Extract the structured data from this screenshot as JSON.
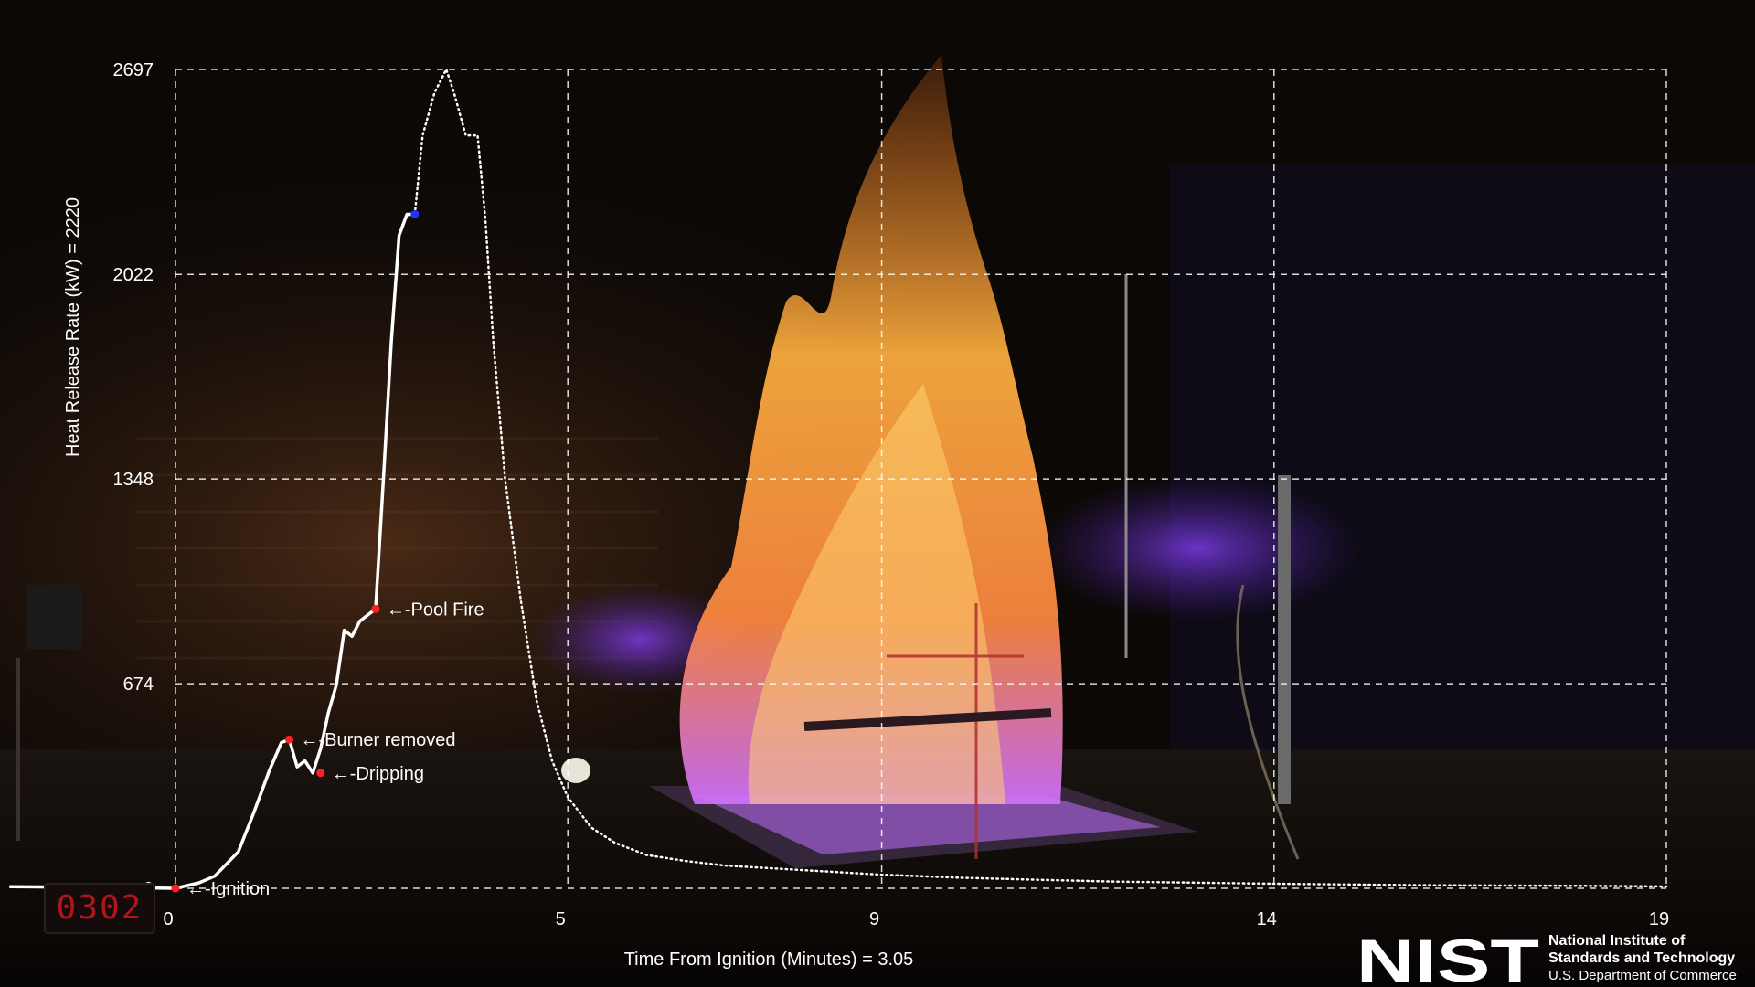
{
  "chart_data": {
    "type": "line",
    "xlabel": "Time From Ignition (Minutes) = 3.05",
    "ylabel": "Heat Release Rate (kW) = 2220",
    "xlim": [
      0,
      19
    ],
    "ylim": [
      0,
      2697
    ],
    "x_ticks": [
      0,
      5,
      9,
      14,
      19
    ],
    "x_tick_labels": [
      "0",
      "5",
      "9",
      "14",
      "19"
    ],
    "y_ticks": [
      0,
      674,
      1348,
      2022,
      2697
    ],
    "y_tick_labels": [
      "0",
      "674",
      "1348",
      "2022",
      "2697"
    ],
    "grid": true,
    "series": [
      {
        "style": "solid",
        "color": "#ffffff",
        "x": [
          -2.1,
          -1.0,
          0,
          0.3,
          0.5,
          0.8,
          1.0,
          1.2,
          1.35,
          1.45,
          1.55,
          1.65,
          1.75,
          1.85,
          1.95,
          2.05,
          2.15,
          2.25,
          2.35,
          2.45,
          2.55,
          2.65,
          2.75,
          2.85,
          2.95,
          3.05
        ],
        "y": [
          5,
          3,
          0,
          18,
          40,
          120,
          250,
          390,
          480,
          490,
          400,
          420,
          380,
          460,
          580,
          670,
          850,
          830,
          880,
          900,
          920,
          1350,
          1800,
          2150,
          2220,
          2220
        ]
      },
      {
        "style": "dotted",
        "color": "#ffffff",
        "x": [
          3.05,
          3.15,
          3.3,
          3.45,
          3.55,
          3.7,
          3.85,
          3.95,
          4.05,
          4.2,
          4.4,
          4.6,
          4.8,
          5.0,
          5.3,
          5.6,
          6.0,
          6.5,
          7.0,
          8.0,
          9.0,
          10.0,
          11.0,
          12.0,
          14.0,
          16.0,
          18.0,
          19.0
        ],
        "y": [
          2220,
          2480,
          2620,
          2697,
          2620,
          2480,
          2480,
          2200,
          1800,
          1350,
          950,
          620,
          420,
          300,
          200,
          150,
          110,
          90,
          75,
          60,
          45,
          35,
          28,
          22,
          15,
          10,
          8,
          6
        ]
      }
    ],
    "markers": [
      {
        "x": 0.0,
        "y": 0,
        "color": "#ff2020",
        "label": "←-Ignition"
      },
      {
        "x": 1.45,
        "y": 490,
        "color": "#ff2020",
        "label": "←-Burner removed"
      },
      {
        "x": 1.85,
        "y": 380,
        "color": "#ff2020",
        "label": "←-Dripping"
      },
      {
        "x": 2.55,
        "y": 920,
        "color": "#ff2020",
        "label": "←-Pool Fire"
      },
      {
        "x": 3.05,
        "y": 2220,
        "color": "#2233ff",
        "label": ""
      }
    ]
  },
  "clock": {
    "value": "0302"
  },
  "logo": {
    "mark": "NIST",
    "line1": "National Institute of",
    "line2": "Standards and Technology",
    "line3": "U.S. Department of Commerce"
  },
  "colors": {
    "background": "#0b0806",
    "flame_core": "#ffb040",
    "flame_base": "#c060ff",
    "curve": "#ffffff",
    "event_marker": "#ff2020",
    "current_marker": "#2233ff"
  }
}
